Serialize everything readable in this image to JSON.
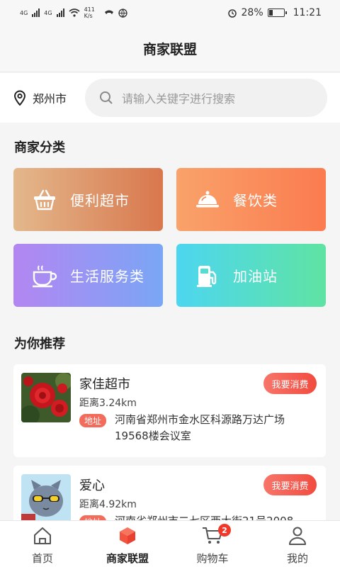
{
  "status_bar": {
    "network_left": "4G",
    "network_right": "4G",
    "speed": "411 K/s",
    "battery": "28%",
    "battery_level": 0.28,
    "time": "11:21"
  },
  "header": {
    "title": "商家联盟"
  },
  "search": {
    "city": "郑州市",
    "placeholder": "请输入关键字进行搜索"
  },
  "categories": {
    "title": "商家分类",
    "items": [
      {
        "label": "便利超市",
        "icon": "basket-icon"
      },
      {
        "label": "餐饮类",
        "icon": "food-cloche-icon"
      },
      {
        "label": "生活服务类",
        "icon": "coffee-cup-icon"
      },
      {
        "label": "加油站",
        "icon": "gas-pump-icon"
      }
    ]
  },
  "recommend": {
    "title": "为你推荐",
    "shops": [
      {
        "name": "家佳超市",
        "distance": "距离3.24km",
        "address_badge": "地址",
        "address": "河南省郑州市金水区科源路万达广场19568楼会议室",
        "button": "我要消费"
      },
      {
        "name": "爱心",
        "distance": "距离4.92km",
        "address_badge": "地址",
        "address": "河南省郑州市二七区西大街21号2008",
        "button": "我要消费"
      }
    ]
  },
  "tabbar": {
    "items": [
      {
        "label": "首页",
        "icon": "home-icon"
      },
      {
        "label": "商家联盟",
        "icon": "cube-icon"
      },
      {
        "label": "购物车",
        "icon": "cart-icon",
        "badge": "2"
      },
      {
        "label": "我的",
        "icon": "user-icon"
      }
    ],
    "active_index": 1,
    "active_color": "#f2543f"
  }
}
